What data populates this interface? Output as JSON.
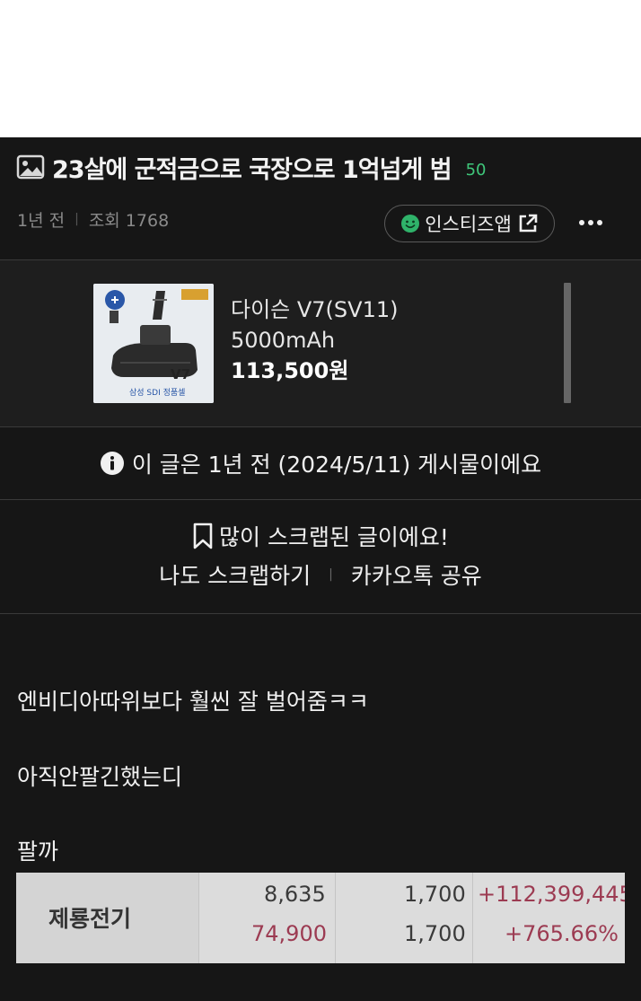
{
  "post": {
    "title": "23살에 군적금으로 국장으로 1억넘게 범",
    "comment_count": "50",
    "time_ago": "1년 전",
    "views": "조회 1768",
    "app_button": "인스티즈앱"
  },
  "ad": {
    "product_name": "다이슨 V7(SV11)",
    "capacity": "5000mAh",
    "price": "113,500원",
    "thumb_label": "삼성 SDI 정품셀",
    "thumb_model": "V7"
  },
  "notice": {
    "text": "이 글은 1년 전 (2024/5/11) 게시물이에요"
  },
  "scrap": {
    "title": "많이 스크랩된 글이에요!",
    "scrap_button": "나도 스크랩하기",
    "kakao_button": "카카오톡 공유"
  },
  "content": {
    "line1": "엔비디아따위보다 훨씬 잘 벌어줌ㅋㅋ",
    "line2": "아직안팔긴했는디",
    "line3": "팔까"
  },
  "stock_table": {
    "name": "제룡전기",
    "avg_price": "8,635",
    "current_price": "74,900",
    "qty1": "1,700",
    "qty2": "1,700",
    "profit": "+112,399,445",
    "return_rate": "+765.66%"
  },
  "colors": {
    "background": "#161616",
    "accent_green": "#3fc77a",
    "profit_red": "#9c3b52"
  },
  "icons": [
    "image-icon",
    "smile-icon",
    "external-link-icon",
    "more-icon",
    "info-icon",
    "bookmark-icon"
  ]
}
